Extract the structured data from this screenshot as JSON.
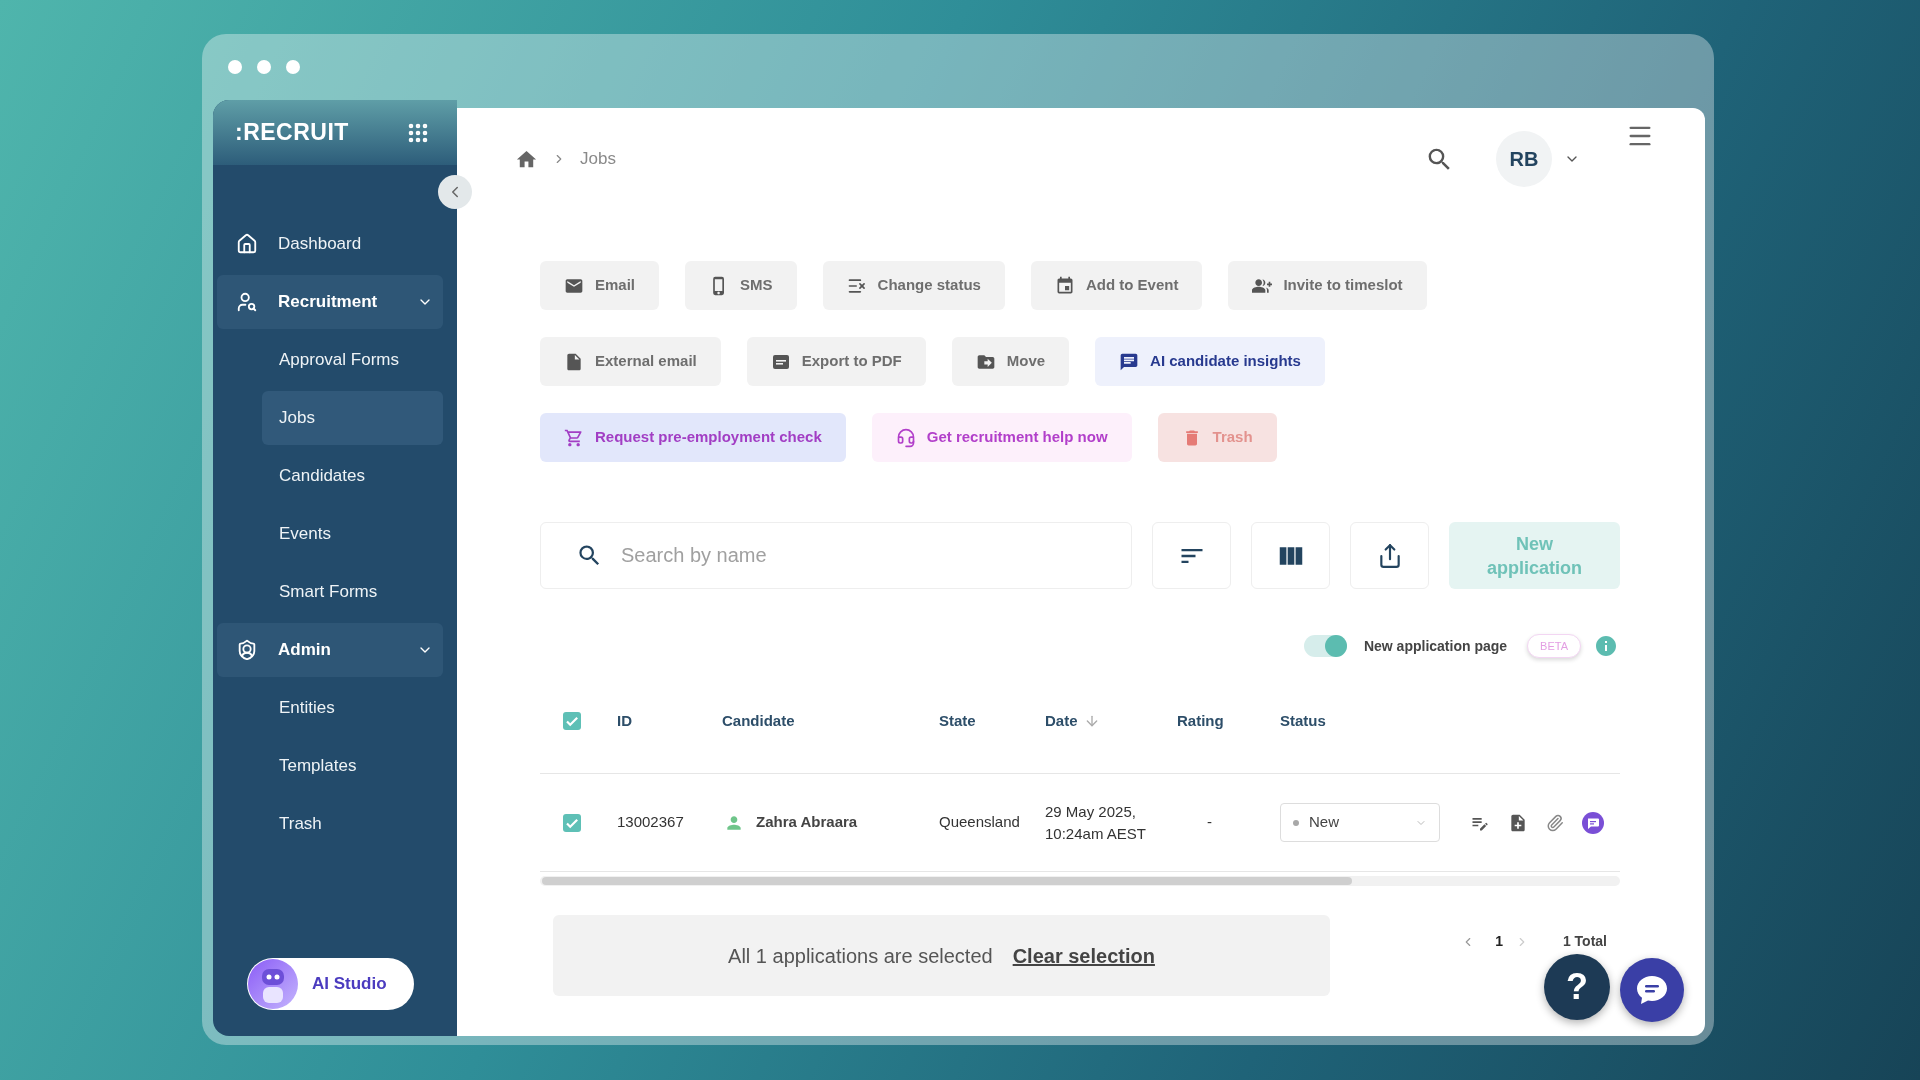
{
  "sidebar": {
    "logo": ":RECRUIT",
    "items": [
      {
        "kind": "link",
        "label": "Dashboard",
        "selected": false
      },
      {
        "kind": "group",
        "label": "Recruitment",
        "expanded": true,
        "children": [
          {
            "label": "Approval Forms",
            "selected": false
          },
          {
            "label": "Jobs",
            "selected": true
          },
          {
            "label": "Candidates",
            "selected": false
          },
          {
            "label": "Events",
            "selected": false
          },
          {
            "label": "Smart Forms",
            "selected": false
          }
        ]
      },
      {
        "kind": "group",
        "label": "Admin",
        "expanded": true,
        "children": [
          {
            "label": "Entities",
            "selected": false
          },
          {
            "label": "Templates",
            "selected": false
          },
          {
            "label": "Trash",
            "selected": false
          }
        ]
      }
    ],
    "ai_studio": {
      "label": "AI Studio"
    }
  },
  "breadcrumb": {
    "current": "Jobs"
  },
  "header": {
    "avatar_initials": "RB"
  },
  "toolbar": {
    "rows": [
      [
        {
          "label": "Email",
          "kind": "neutral"
        },
        {
          "label": "SMS",
          "kind": "neutral"
        },
        {
          "label": "Change status",
          "kind": "neutral"
        },
        {
          "label": "Add to Event",
          "kind": "neutral"
        },
        {
          "label": "Invite to timeslot",
          "kind": "neutral"
        }
      ],
      [
        {
          "label": "External email",
          "kind": "neutral"
        },
        {
          "label": "Export to PDF",
          "kind": "neutral"
        },
        {
          "label": "Move",
          "kind": "neutral"
        },
        {
          "label": "AI candidate insights",
          "kind": "insight"
        }
      ],
      [
        {
          "label": "Request pre-employment check",
          "kind": "check"
        },
        {
          "label": "Get recruitment help now",
          "kind": "help"
        },
        {
          "label": "Trash",
          "kind": "danger"
        }
      ]
    ]
  },
  "search": {
    "placeholder": "Search by name"
  },
  "new_application_button": {
    "label": "New application"
  },
  "new_page_toggle": {
    "on": true,
    "label": "New application page",
    "badge": "BETA"
  },
  "table": {
    "all_checked": true,
    "columns": [
      {
        "label": "ID",
        "sorted": false
      },
      {
        "label": "Candidate",
        "sorted": false
      },
      {
        "label": "State",
        "sorted": false
      },
      {
        "label": "Date",
        "sorted": true
      },
      {
        "label": "Rating",
        "sorted": false
      },
      {
        "label": "Status",
        "sorted": false
      }
    ],
    "rows": [
      {
        "checked": true,
        "id": "13002367",
        "candidate": "Zahra Abraara",
        "state": "Queensland",
        "date": "29 May 2025, 10:24am AEST",
        "rating": "-",
        "status": "New"
      }
    ]
  },
  "selection_banner": {
    "text": "All 1 applications are selected",
    "action": "Clear selection"
  },
  "pagination": {
    "pages": [
      {
        "label": "1",
        "selected": true
      }
    ],
    "total": "1 Total"
  },
  "help_button": {
    "label": "?"
  }
}
